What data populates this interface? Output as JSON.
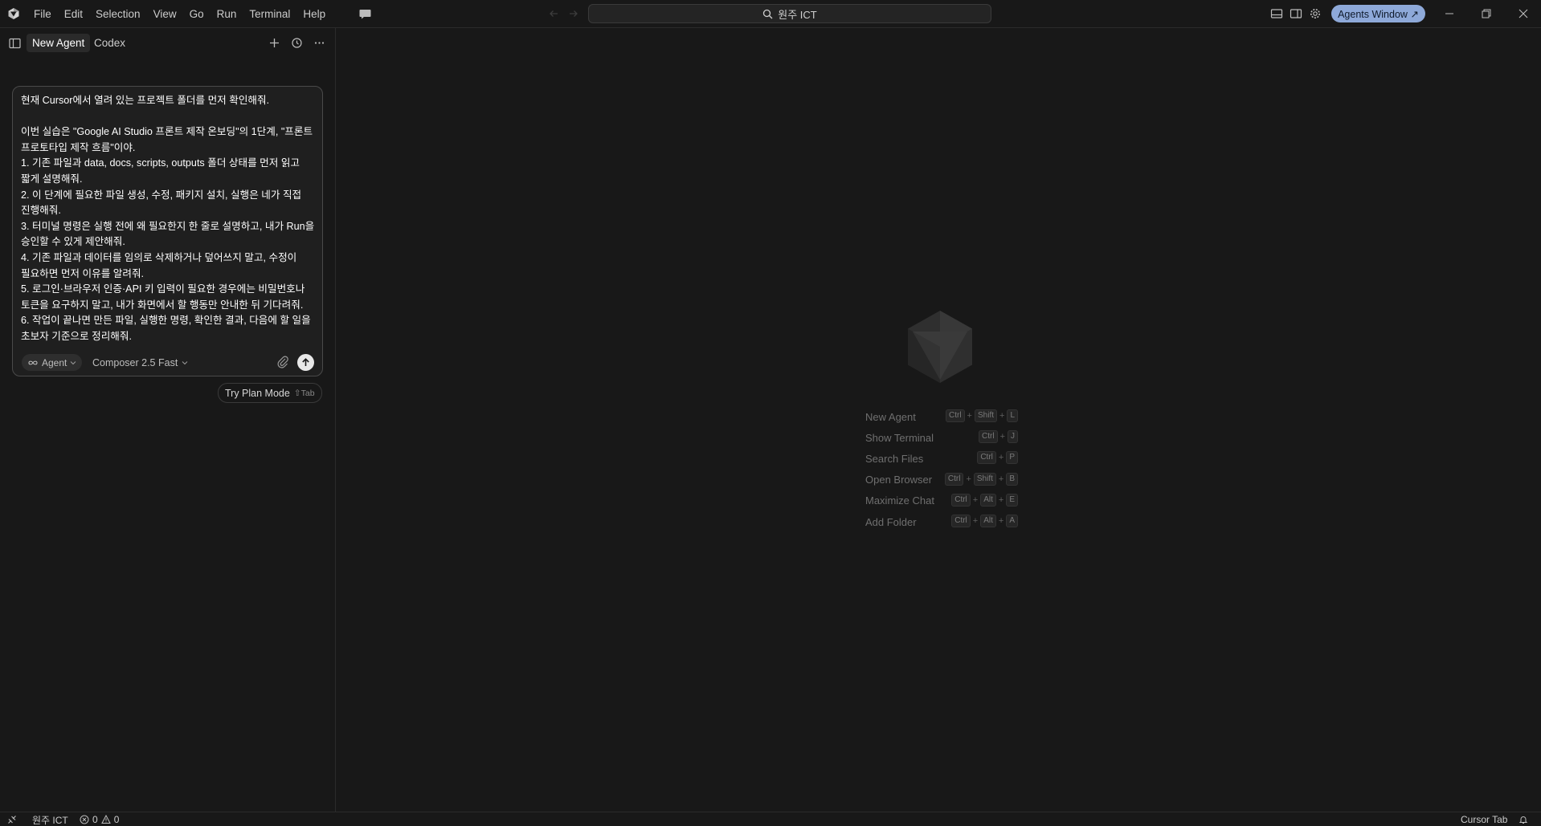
{
  "menubar": {
    "items": [
      "File",
      "Edit",
      "Selection",
      "View",
      "Go",
      "Run",
      "Terminal",
      "Help"
    ]
  },
  "command_center": {
    "label": "원주 ICT"
  },
  "agents_window": {
    "label": "Agents Window ↗"
  },
  "panel": {
    "tabs": [
      "New Agent",
      "Codex"
    ]
  },
  "composer": {
    "lines": [
      "현재 Cursor에서 열려 있는 프로젝트 폴더를 먼저 확인해줘.",
      "",
      "이번 실습은 \"Google AI Studio 프론트 제작 온보딩\"의 1단계, \"프론트 프로토타입 제작 흐름\"이야.",
      "1. 기존 파일과 data, docs, scripts, outputs 폴더 상태를 먼저 읽고 짧게 설명해줘.",
      "2. 이 단계에 필요한 파일 생성, 수정, 패키지 설치, 실행은 네가 직접 진행해줘.",
      "3. 터미널 명령은 실행 전에 왜 필요한지 한 줄로 설명하고, 내가 Run을 승인할 수 있게 제안해줘.",
      "4. 기존 파일과 데이터를 임의로 삭제하거나 덮어쓰지 말고, 수정이 필요하면 먼저 이유를 알려줘.",
      "5. 로그인·브라우저 인증·API 키 입력이 필요한 경우에는 비밀번호나 토큰을 요구하지 말고, 내가 화면에서 할 행동만 안내한 뒤 기다려줘.",
      "6. 작업이 끝나면 만든 파일, 실행한 명령, 확인한 결과, 다음에 할 일을 초보자 기준으로 정리해줘."
    ],
    "mode": "Agent",
    "model": "Composer 2.5 Fast"
  },
  "plan_mode": {
    "label": "Try Plan Mode",
    "shortcut": "⇧Tab"
  },
  "shortcuts": [
    {
      "label": "New Agent",
      "keys": [
        "Ctrl",
        "Shift",
        "L"
      ]
    },
    {
      "label": "Show Terminal",
      "keys": [
        "Ctrl",
        "J"
      ]
    },
    {
      "label": "Search Files",
      "keys": [
        "Ctrl",
        "P"
      ]
    },
    {
      "label": "Open Browser",
      "keys": [
        "Ctrl",
        "Shift",
        "B"
      ]
    },
    {
      "label": "Maximize Chat",
      "keys": [
        "Ctrl",
        "Alt",
        "E"
      ]
    },
    {
      "label": "Add Folder",
      "keys": [
        "Ctrl",
        "Alt",
        "A"
      ]
    }
  ],
  "statusbar": {
    "workspace": "원주 ICT",
    "errors": "0",
    "warnings": "0",
    "cursor_tab": "Cursor Tab"
  },
  "colors": {
    "background": "#181818",
    "accent": "#8ea9d9",
    "border": "#2b2b2b"
  },
  "icons": [
    "cursor-logo-icon",
    "chat-icon",
    "search-icon",
    "layout-icon",
    "settings-icon",
    "minimize-icon",
    "restore-icon",
    "close-icon",
    "sidebar-toggle-icon",
    "plus-icon",
    "history-icon",
    "more-icon",
    "infinity-icon",
    "chevron-down-icon",
    "paperclip-icon",
    "arrow-up-icon",
    "remote-icon",
    "error-icon",
    "warning-icon",
    "bell-icon"
  ]
}
